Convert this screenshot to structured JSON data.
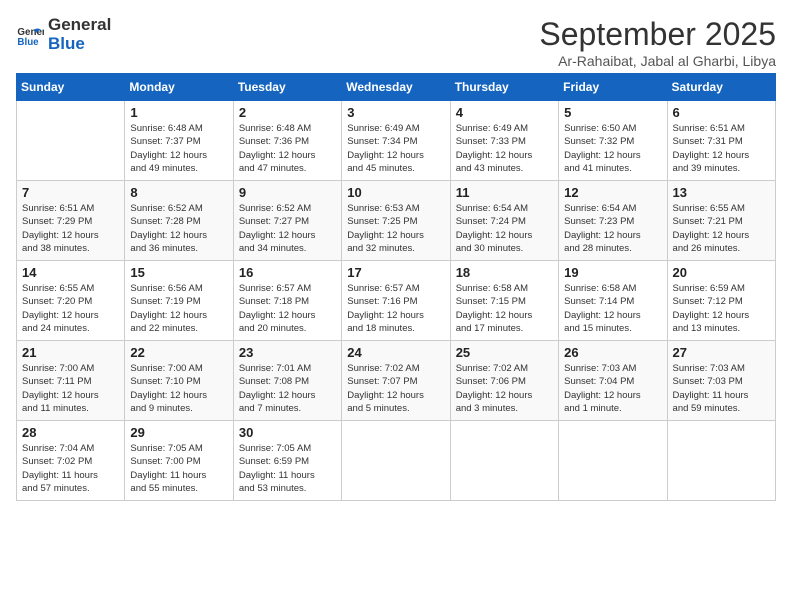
{
  "header": {
    "logo_line1": "General",
    "logo_line2": "Blue",
    "month": "September 2025",
    "location": "Ar-Rahaibat, Jabal al Gharbi, Libya"
  },
  "days_of_week": [
    "Sunday",
    "Monday",
    "Tuesday",
    "Wednesday",
    "Thursday",
    "Friday",
    "Saturday"
  ],
  "weeks": [
    [
      {
        "day": "",
        "info": ""
      },
      {
        "day": "1",
        "info": "Sunrise: 6:48 AM\nSunset: 7:37 PM\nDaylight: 12 hours\nand 49 minutes."
      },
      {
        "day": "2",
        "info": "Sunrise: 6:48 AM\nSunset: 7:36 PM\nDaylight: 12 hours\nand 47 minutes."
      },
      {
        "day": "3",
        "info": "Sunrise: 6:49 AM\nSunset: 7:34 PM\nDaylight: 12 hours\nand 45 minutes."
      },
      {
        "day": "4",
        "info": "Sunrise: 6:49 AM\nSunset: 7:33 PM\nDaylight: 12 hours\nand 43 minutes."
      },
      {
        "day": "5",
        "info": "Sunrise: 6:50 AM\nSunset: 7:32 PM\nDaylight: 12 hours\nand 41 minutes."
      },
      {
        "day": "6",
        "info": "Sunrise: 6:51 AM\nSunset: 7:31 PM\nDaylight: 12 hours\nand 39 minutes."
      }
    ],
    [
      {
        "day": "7",
        "info": "Sunrise: 6:51 AM\nSunset: 7:29 PM\nDaylight: 12 hours\nand 38 minutes."
      },
      {
        "day": "8",
        "info": "Sunrise: 6:52 AM\nSunset: 7:28 PM\nDaylight: 12 hours\nand 36 minutes."
      },
      {
        "day": "9",
        "info": "Sunrise: 6:52 AM\nSunset: 7:27 PM\nDaylight: 12 hours\nand 34 minutes."
      },
      {
        "day": "10",
        "info": "Sunrise: 6:53 AM\nSunset: 7:25 PM\nDaylight: 12 hours\nand 32 minutes."
      },
      {
        "day": "11",
        "info": "Sunrise: 6:54 AM\nSunset: 7:24 PM\nDaylight: 12 hours\nand 30 minutes."
      },
      {
        "day": "12",
        "info": "Sunrise: 6:54 AM\nSunset: 7:23 PM\nDaylight: 12 hours\nand 28 minutes."
      },
      {
        "day": "13",
        "info": "Sunrise: 6:55 AM\nSunset: 7:21 PM\nDaylight: 12 hours\nand 26 minutes."
      }
    ],
    [
      {
        "day": "14",
        "info": "Sunrise: 6:55 AM\nSunset: 7:20 PM\nDaylight: 12 hours\nand 24 minutes."
      },
      {
        "day": "15",
        "info": "Sunrise: 6:56 AM\nSunset: 7:19 PM\nDaylight: 12 hours\nand 22 minutes."
      },
      {
        "day": "16",
        "info": "Sunrise: 6:57 AM\nSunset: 7:18 PM\nDaylight: 12 hours\nand 20 minutes."
      },
      {
        "day": "17",
        "info": "Sunrise: 6:57 AM\nSunset: 7:16 PM\nDaylight: 12 hours\nand 18 minutes."
      },
      {
        "day": "18",
        "info": "Sunrise: 6:58 AM\nSunset: 7:15 PM\nDaylight: 12 hours\nand 17 minutes."
      },
      {
        "day": "19",
        "info": "Sunrise: 6:58 AM\nSunset: 7:14 PM\nDaylight: 12 hours\nand 15 minutes."
      },
      {
        "day": "20",
        "info": "Sunrise: 6:59 AM\nSunset: 7:12 PM\nDaylight: 12 hours\nand 13 minutes."
      }
    ],
    [
      {
        "day": "21",
        "info": "Sunrise: 7:00 AM\nSunset: 7:11 PM\nDaylight: 12 hours\nand 11 minutes."
      },
      {
        "day": "22",
        "info": "Sunrise: 7:00 AM\nSunset: 7:10 PM\nDaylight: 12 hours\nand 9 minutes."
      },
      {
        "day": "23",
        "info": "Sunrise: 7:01 AM\nSunset: 7:08 PM\nDaylight: 12 hours\nand 7 minutes."
      },
      {
        "day": "24",
        "info": "Sunrise: 7:02 AM\nSunset: 7:07 PM\nDaylight: 12 hours\nand 5 minutes."
      },
      {
        "day": "25",
        "info": "Sunrise: 7:02 AM\nSunset: 7:06 PM\nDaylight: 12 hours\nand 3 minutes."
      },
      {
        "day": "26",
        "info": "Sunrise: 7:03 AM\nSunset: 7:04 PM\nDaylight: 12 hours\nand 1 minute."
      },
      {
        "day": "27",
        "info": "Sunrise: 7:03 AM\nSunset: 7:03 PM\nDaylight: 11 hours\nand 59 minutes."
      }
    ],
    [
      {
        "day": "28",
        "info": "Sunrise: 7:04 AM\nSunset: 7:02 PM\nDaylight: 11 hours\nand 57 minutes."
      },
      {
        "day": "29",
        "info": "Sunrise: 7:05 AM\nSunset: 7:00 PM\nDaylight: 11 hours\nand 55 minutes."
      },
      {
        "day": "30",
        "info": "Sunrise: 7:05 AM\nSunset: 6:59 PM\nDaylight: 11 hours\nand 53 minutes."
      },
      {
        "day": "",
        "info": ""
      },
      {
        "day": "",
        "info": ""
      },
      {
        "day": "",
        "info": ""
      },
      {
        "day": "",
        "info": ""
      }
    ]
  ]
}
